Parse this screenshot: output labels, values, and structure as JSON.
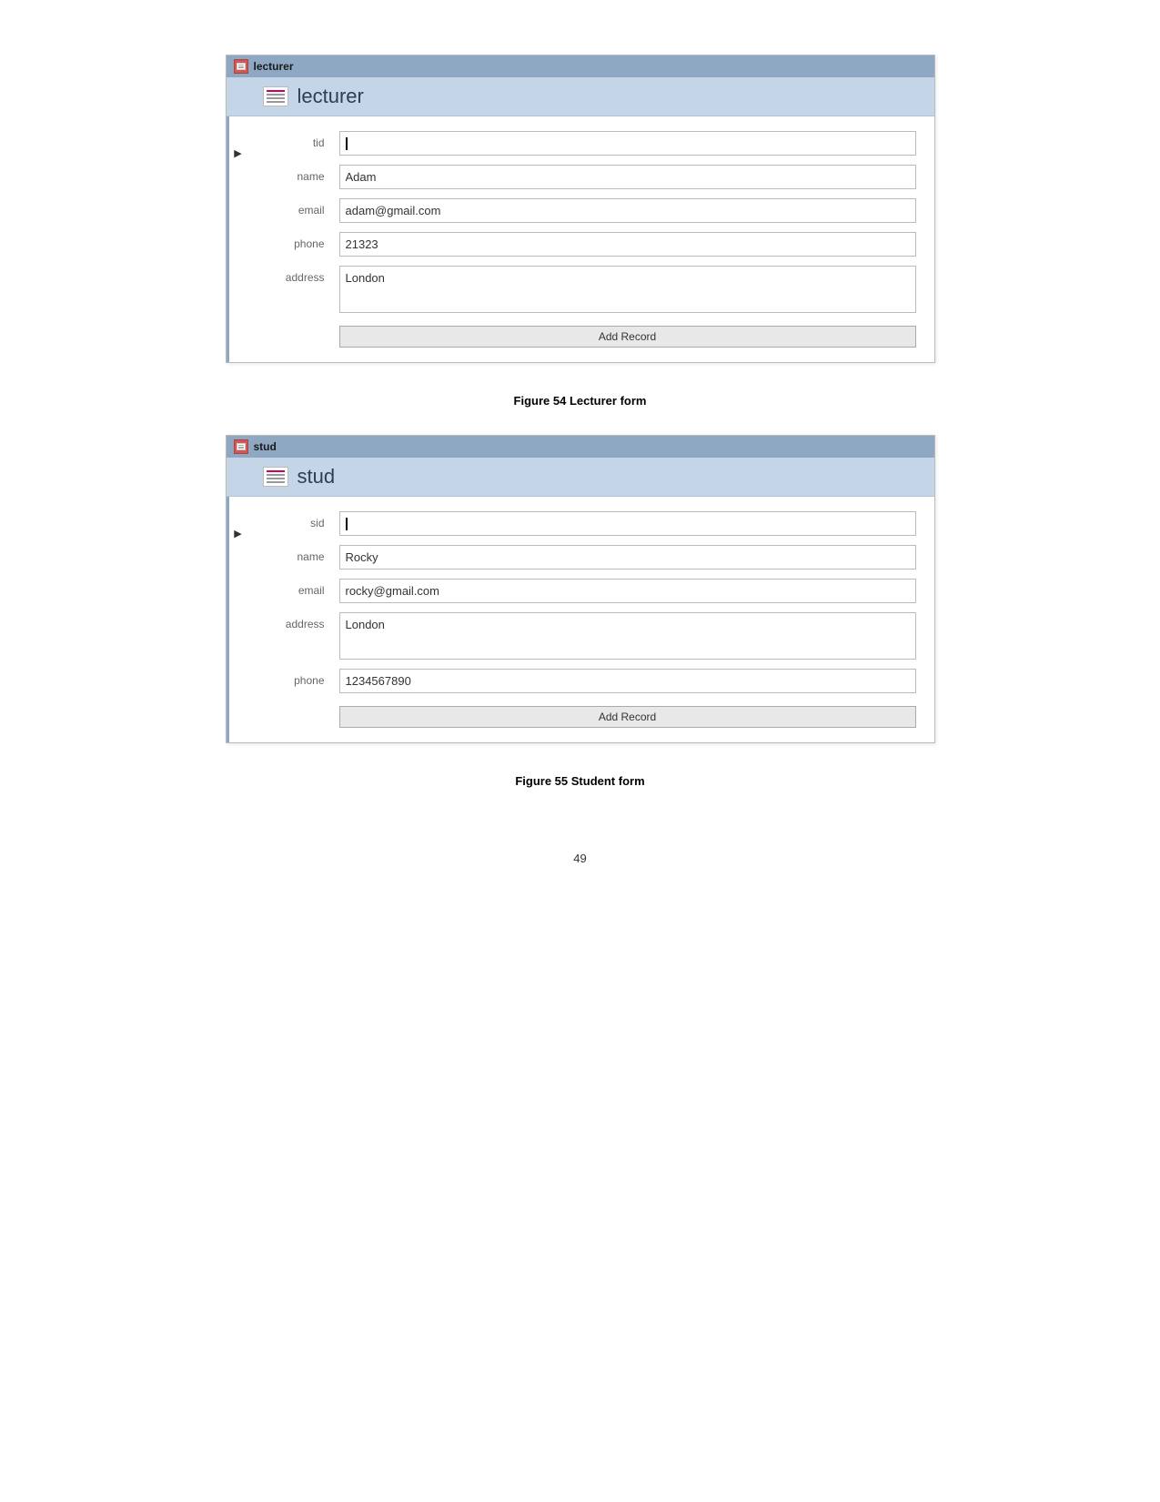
{
  "lecturer_form": {
    "title_bar_label": "lecturer",
    "header_label": "lecturer",
    "fields": [
      {
        "label": "tid",
        "value": "",
        "type": "text",
        "multiline": false,
        "cursor": true
      },
      {
        "label": "name",
        "value": "Adam",
        "type": "text",
        "multiline": false,
        "cursor": false
      },
      {
        "label": "email",
        "value": "adam@gmail.com",
        "type": "text",
        "multiline": false,
        "cursor": false
      },
      {
        "label": "phone",
        "value": "21323",
        "type": "text",
        "multiline": false,
        "cursor": false
      },
      {
        "label": "address",
        "value": "London",
        "type": "text",
        "multiline": true,
        "cursor": false
      }
    ],
    "add_record_label": "Add Record",
    "caption": "Figure 54 Lecturer form"
  },
  "stud_form": {
    "title_bar_label": "stud",
    "header_label": "stud",
    "fields": [
      {
        "label": "sid",
        "value": "",
        "type": "text",
        "multiline": false,
        "cursor": true
      },
      {
        "label": "name",
        "value": "Rocky",
        "type": "text",
        "multiline": false,
        "cursor": false
      },
      {
        "label": "email",
        "value": "rocky@gmail.com",
        "type": "text",
        "multiline": false,
        "cursor": false
      },
      {
        "label": "address",
        "value": "London",
        "type": "text",
        "multiline": true,
        "cursor": false
      },
      {
        "label": "phone",
        "value": "1234567890",
        "type": "text",
        "multiline": false,
        "cursor": false
      }
    ],
    "add_record_label": "Add Record",
    "caption": "Figure 55 Student form"
  },
  "page_number": "49"
}
